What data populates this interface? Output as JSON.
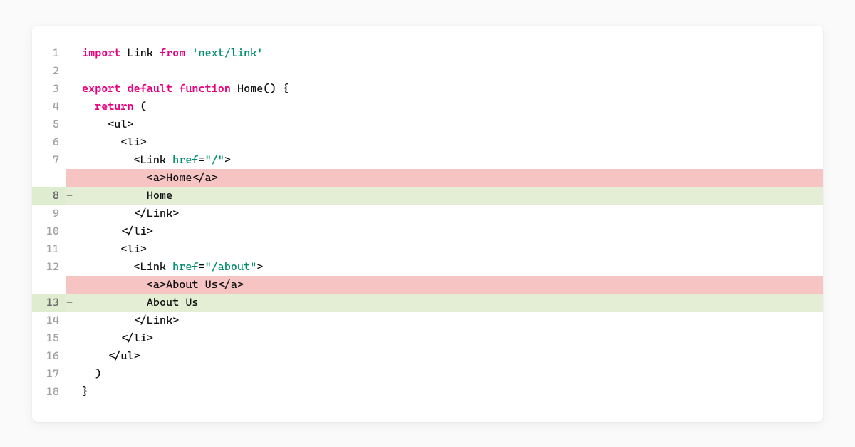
{
  "symbols": {
    "lt": "<",
    "gt": ">",
    "lts": "</",
    "op": "(",
    "cp": ")",
    "ob": "{",
    "cb": "}",
    "eq": "=",
    "dash": "-"
  },
  "code": {
    "kw_import": "import",
    "id_link": "Link",
    "kw_from": "from",
    "str_nextlink": "'next/link'",
    "kw_export": "export",
    "kw_default": "default",
    "kw_function": "function",
    "id_home": "Home",
    "kw_return": "return",
    "tag_ul": "ul",
    "tag_li": "li",
    "tag_link": "Link",
    "tag_a": "a",
    "attr_href": "href",
    "val_root": "\"/\"",
    "val_about": "\"/about\"",
    "txt_home": "Home",
    "txt_aboutus": "About Us"
  },
  "lineNumbers": {
    "l1": "1",
    "l2": "2",
    "l3": "3",
    "l4": "4",
    "l5": "5",
    "l6": "6",
    "l7": "7",
    "l8": "8",
    "l9": "9",
    "l10": "10",
    "l11": "11",
    "l12": "12",
    "l13": "13",
    "l14": "14",
    "l15": "15",
    "l16": "16",
    "l17": "17",
    "l18": "18"
  },
  "indent": {
    "i0": "",
    "i1": "  ",
    "i2": "    ",
    "i3": "      ",
    "i4": "        ",
    "i5": "          "
  }
}
